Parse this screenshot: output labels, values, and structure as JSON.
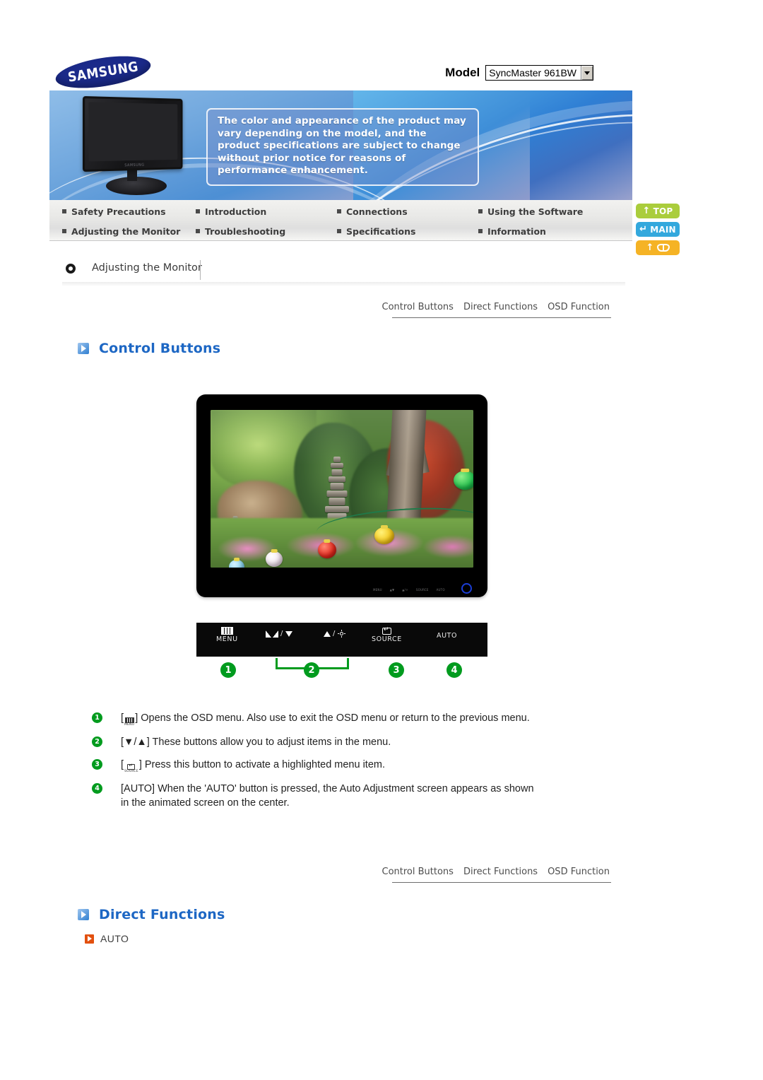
{
  "header": {
    "logo_text": "SAMSUNG",
    "model_label": "Model",
    "model_value": "SyncMaster 961BW"
  },
  "banner": {
    "notice": "The color and appearance of the product may vary depending on the model, and the product specifications are subject to change without prior notice for reasons of performance enhancement."
  },
  "nav": {
    "items": [
      "Safety Precautions",
      "Introduction",
      "Connections",
      "Using the Software",
      "Adjusting the Monitor",
      "Troubleshooting",
      "Specifications",
      "Information"
    ]
  },
  "side_buttons": [
    {
      "label": "TOP",
      "icon": "arrow-up-icon",
      "color": "#aacd3c"
    },
    {
      "label": "MAIN",
      "icon": "arrow-turn-icon",
      "color": "#33a8dd"
    },
    {
      "label": "",
      "icon": "bookmark-icon",
      "color": "#f5b325"
    }
  ],
  "section": {
    "title": "Adjusting the Monitor"
  },
  "minitabs": [
    "Control Buttons",
    "Direct Functions",
    "OSD Function"
  ],
  "headings": {
    "control_buttons": "Control Buttons",
    "direct_functions": "Direct Functions"
  },
  "control_panel": {
    "buttons": [
      {
        "label": "MENU",
        "icon": "menu-bars-icon"
      },
      {
        "label": "",
        "icon": "contrast-down-icon",
        "glyph": "/"
      },
      {
        "label": "",
        "icon": "up-brightness-icon",
        "glyph": "/"
      },
      {
        "label": "SOURCE",
        "icon": "enter-icon"
      },
      {
        "label": "AUTO",
        "icon": ""
      }
    ],
    "callouts": [
      "1",
      "2",
      "3",
      "4"
    ]
  },
  "descriptions": [
    {
      "num": "1",
      "pre": "[",
      "icon_caption": "MENU",
      "post": "] Opens the OSD menu. Also use to exit the OSD menu or return to the previous menu."
    },
    {
      "num": "2",
      "text": "[▼/▲] These buttons allow you to adjust items in the menu."
    },
    {
      "num": "3",
      "pre": "[",
      "icon_caption": "SOURCE",
      "post": "] Press this button to activate a highlighted menu item."
    },
    {
      "num": "4",
      "text": "[AUTO] When the 'AUTO' button is pressed, the Auto Adjustment screen appears as shown in the animated screen on the center."
    }
  ],
  "direct_functions": {
    "items": [
      "AUTO"
    ]
  },
  "colors": {
    "heading_blue": "#1d67c4",
    "badge_green": "#009b1e",
    "auto_orange": "#e2500f",
    "samsung_navy": "#1b2a8a"
  }
}
